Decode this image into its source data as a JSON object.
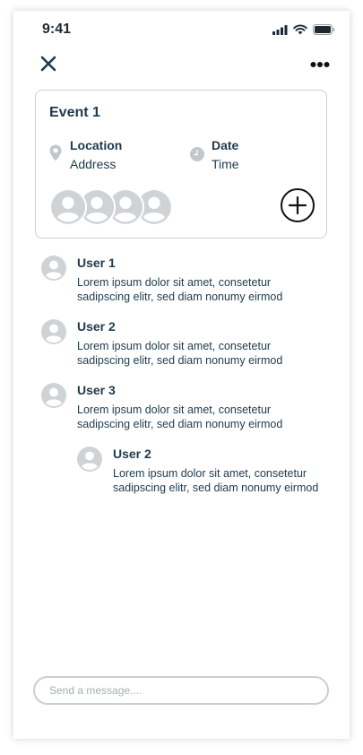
{
  "status_bar": {
    "time": "9:41"
  },
  "event": {
    "title": "Event 1",
    "location_label": "Location",
    "location_value": "Address",
    "date_label": "Date",
    "date_value": "Time",
    "attendee_count": 4
  },
  "comments": [
    {
      "user": "User 1",
      "text": "Lorem ipsum dolor sit amet, consetetur sadipscing elitr, sed diam nonumy eirmod",
      "reply": false
    },
    {
      "user": "User 2",
      "text": "Lorem ipsum dolor sit amet, consetetur sadipscing elitr, sed diam nonumy eirmod",
      "reply": false
    },
    {
      "user": "User 3",
      "text": "Lorem ipsum dolor sit amet, consetetur sadipscing elitr, sed diam nonumy eirmod",
      "reply": false
    },
    {
      "user": "User 2",
      "text": "Lorem ipsum dolor sit amet, consetetur sadipscing elitr, sed diam nonumy eirmod",
      "reply": true
    }
  ],
  "composer": {
    "placeholder": "Send a message...."
  },
  "icons": {
    "close": "close-icon",
    "more": "more-icon",
    "location": "map-pin-icon",
    "clock": "clock-icon",
    "add": "plus-circle-icon",
    "avatar": "user-avatar-icon"
  },
  "colors": {
    "text": "#1e3a4c",
    "border": "#c9cfd3",
    "avatar_bg": "#d0d3d5",
    "placeholder": "#a7aeb3"
  }
}
